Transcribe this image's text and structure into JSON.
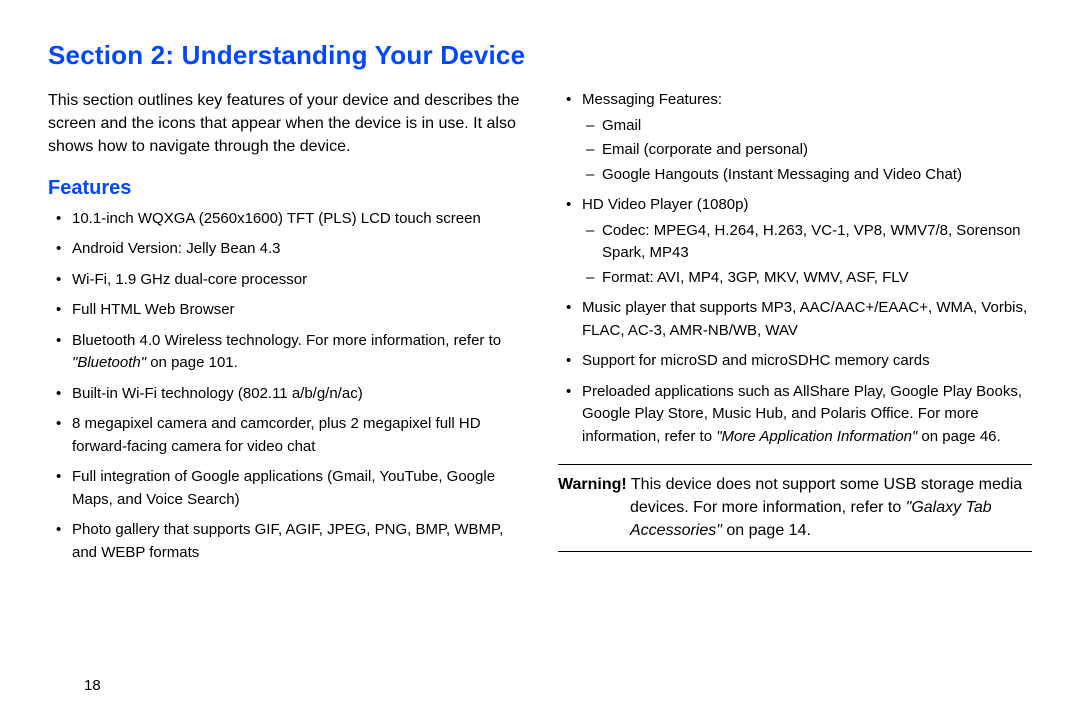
{
  "section_title": "Section 2: Understanding Your Device",
  "intro": "This section outlines key features of your device and describes the screen and the icons that appear when the device is in use. It also shows how to navigate through the device.",
  "features_heading": "Features",
  "left_bullets": {
    "b0": "10.1-inch WQXGA (2560x1600) TFT (PLS) LCD touch screen",
    "b1": "Android Version: Jelly Bean 4.3",
    "b2": "Wi-Fi, 1.9 GHz dual-core processor",
    "b3": "Full HTML Web Browser",
    "b4_pre": "Bluetooth 4.0 Wireless technology. For more information, refer to ",
    "b4_ref": "\"Bluetooth\"",
    "b4_post": " on page 101.",
    "b5": "Built-in Wi-Fi technology (802.11 a/b/g/n/ac)",
    "b6": "8 megapixel camera and camcorder, plus 2 megapixel full HD forward-facing camera for video chat",
    "b7": "Full integration of Google applications (Gmail, YouTube, Google Maps, and Voice Search)",
    "b8": "Photo gallery that supports GIF, AGIF, JPEG, PNG, BMP, WBMP, and WEBP formats"
  },
  "right_bullets": {
    "msg_label": "Messaging Features:",
    "msg_sub": {
      "s0": "Gmail",
      "s1": "Email (corporate and personal)",
      "s2": "Google Hangouts (Instant Messaging and Video Chat)"
    },
    "hd_label": "HD Video Player (1080p)",
    "hd_sub": {
      "s0": "Codec: MPEG4, H.264, H.263, VC-1, VP8, WMV7/8, Sorenson Spark, MP43",
      "s1": "Format: AVI, MP4, 3GP, MKV, WMV, ASF, FLV"
    },
    "music": "Music player that supports MP3, AAC/AAC+/EAAC+, WMA, Vorbis, FLAC, AC-3, AMR-NB/WB, WAV",
    "sd": "Support for microSD and microSDHC memory cards",
    "preload_pre": "Preloaded applications such as AllShare Play, Google Play Books, Google Play Store, Music Hub, and Polaris Office. For more information, refer to ",
    "preload_ref": "\"More Application Information\"",
    "preload_post": " on page 46."
  },
  "warning": {
    "label": "Warning!",
    "body_pre": " This device does not support some USB storage media devices. For more information, refer to ",
    "body_ref": "\"Galaxy Tab Accessories\"",
    "body_post": " on page 14."
  },
  "page_number": "18"
}
